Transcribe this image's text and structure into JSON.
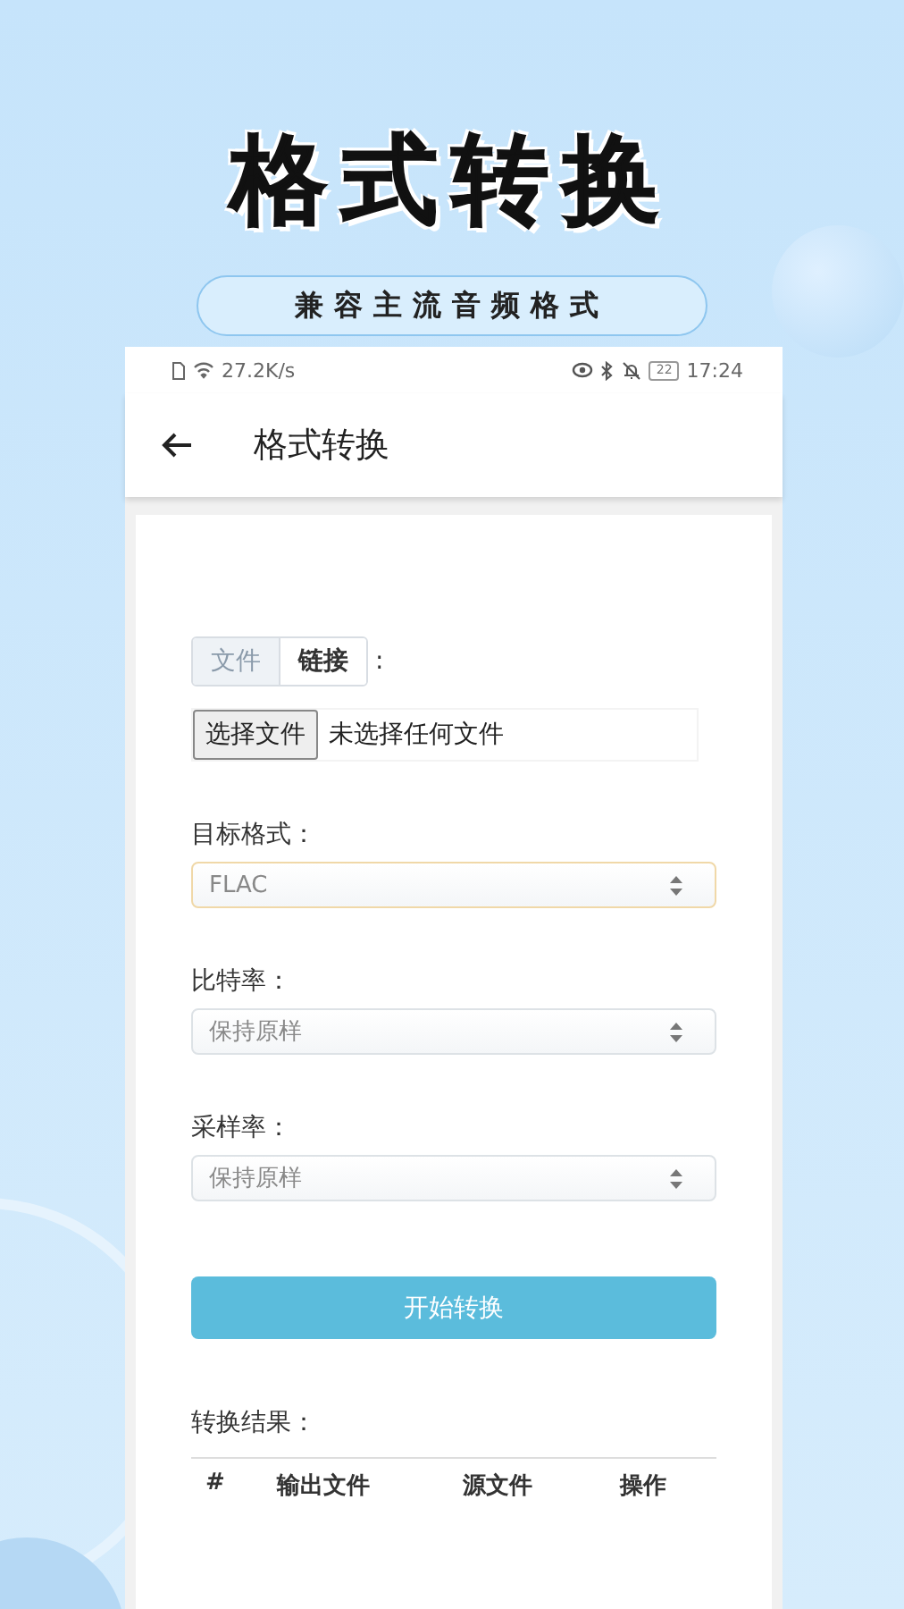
{
  "promo": {
    "title": "格式转换",
    "subtitle": "兼容主流音频格式"
  },
  "status_bar": {
    "network_speed": "27.2K/s",
    "battery": "22",
    "time": "17:24"
  },
  "toolbar": {
    "title": "格式转换"
  },
  "source_tabs": [
    {
      "label": "文件",
      "selected": false
    },
    {
      "label": "链接",
      "selected": true
    }
  ],
  "tabs_suffix": ":",
  "file_picker": {
    "button": "选择文件",
    "status": "未选择任何文件"
  },
  "fields": [
    {
      "label": "目标格式：",
      "value": "FLAC",
      "focused": true
    },
    {
      "label": "比特率：",
      "value": "保持原样",
      "focused": false
    },
    {
      "label": "采样率：",
      "value": "保持原样",
      "focused": false
    }
  ],
  "convert_button": "开始转换",
  "results": {
    "label": "转换结果：",
    "columns": [
      "#",
      "输出文件",
      "源文件",
      "操作"
    ]
  }
}
